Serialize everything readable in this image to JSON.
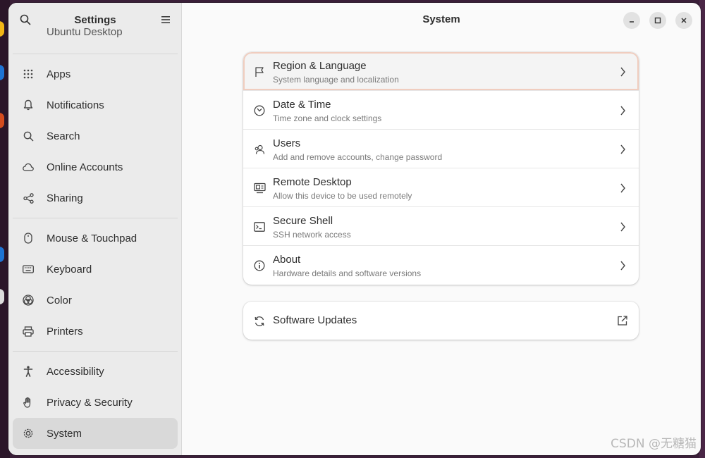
{
  "sidebar": {
    "title": "Settings",
    "items": [
      {
        "label": "Ubuntu Desktop",
        "icon": "desktop-icon",
        "cut": true
      },
      {
        "label": "Apps",
        "icon": "apps-grid-icon"
      },
      {
        "label": "Notifications",
        "icon": "bell-icon"
      },
      {
        "label": "Search",
        "icon": "search-icon"
      },
      {
        "label": "Online Accounts",
        "icon": "cloud-icon"
      },
      {
        "label": "Sharing",
        "icon": "share-icon"
      },
      {
        "label": "Mouse & Touchpad",
        "icon": "mouse-icon"
      },
      {
        "label": "Keyboard",
        "icon": "keyboard-icon"
      },
      {
        "label": "Color",
        "icon": "color-icon"
      },
      {
        "label": "Printers",
        "icon": "printer-icon"
      },
      {
        "label": "Accessibility",
        "icon": "accessibility-icon"
      },
      {
        "label": "Privacy & Security",
        "icon": "hand-icon"
      },
      {
        "label": "System",
        "icon": "gear-icon",
        "active": true
      }
    ]
  },
  "main": {
    "title": "System",
    "rows": [
      {
        "title": "Region & Language",
        "subtitle": "System language and localization",
        "icon": "flag-icon"
      },
      {
        "title": "Date & Time",
        "subtitle": "Time zone and clock settings",
        "icon": "clock-icon"
      },
      {
        "title": "Users",
        "subtitle": "Add and remove accounts, change password",
        "icon": "users-icon"
      },
      {
        "title": "Remote Desktop",
        "subtitle": "Allow this device to be used remotely",
        "icon": "remote-desktop-icon"
      },
      {
        "title": "Secure Shell",
        "subtitle": "SSH network access",
        "icon": "terminal-icon"
      },
      {
        "title": "About",
        "subtitle": "Hardware details and software versions",
        "icon": "info-icon"
      }
    ],
    "updates": {
      "title": "Software Updates",
      "icon": "refresh-icon"
    }
  },
  "watermark": "CSDN @无糖猫",
  "colors": {
    "highlight_border": "#f0cdbf",
    "sidebar_bg": "#ebebeb",
    "window_bg": "#fafafa"
  }
}
